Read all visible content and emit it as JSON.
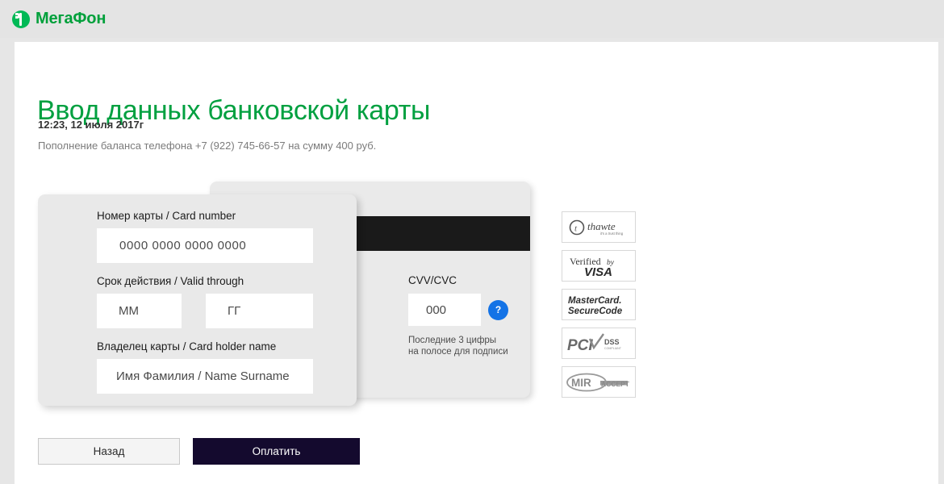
{
  "header": {
    "logo_text": "МегаФон",
    "logo_icon": "megafon-logo-icon",
    "brand_color": "#00a03b"
  },
  "page": {
    "title": "Ввод данных банковской карты",
    "timestamp": "12:23, 12 июля 2017г",
    "description": "Пополнение баланса телефона +7 (922) 745-66-57 на сумму 400 руб.",
    "title_color": "#00a040"
  },
  "card_front": {
    "fields": [
      {
        "label": "Номер карты / Card number",
        "placeholder": "0000  0000  0000  0000",
        "value": ""
      },
      {
        "label": "Срок действия / Valid through",
        "placeholder_month": "ММ",
        "placeholder_year": "ГГ",
        "value_month": "",
        "value_year": ""
      },
      {
        "label": "Владелец карты / Card holder name",
        "placeholder": "Имя Фамилия / Name Surname",
        "value": ""
      }
    ]
  },
  "card_back": {
    "cvv_label": "CVV/CVC",
    "cvv_placeholder": "000",
    "cvv_value": "",
    "help_glyph": "?",
    "help_color": "#1473e6",
    "hint_line1": "Последние 3 цифры",
    "hint_line2": "на полосе для подписи"
  },
  "badges": [
    {
      "name": "thawte-badge",
      "primary": "thawte",
      "secondary": "it's a trust thing"
    },
    {
      "name": "verified-by-visa-badge",
      "primary": "Verified by",
      "secondary": "VISA"
    },
    {
      "name": "mastercard-securecode-badge",
      "primary": "MasterCard.",
      "secondary": "SecureCode"
    },
    {
      "name": "pci-dss-badge",
      "primary": "PCI",
      "secondary": "DSS COMPLIANT"
    },
    {
      "name": "mir-accept-badge",
      "primary": "MIR",
      "secondary": "ACCEPT"
    }
  ],
  "actions": {
    "back_label": "Назад",
    "pay_label": "Оплатить",
    "pay_color": "#140a2e"
  }
}
